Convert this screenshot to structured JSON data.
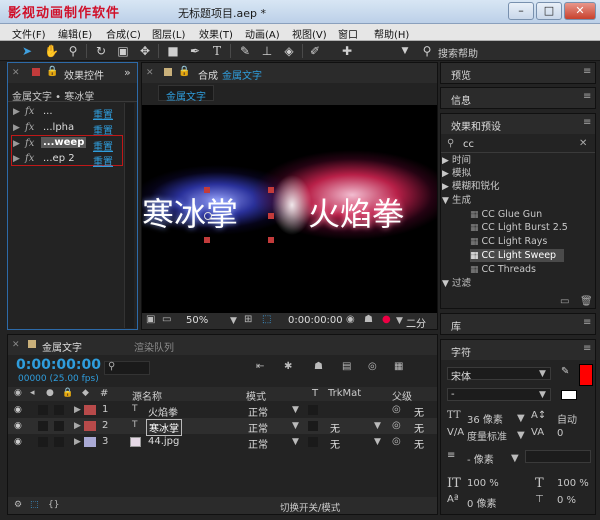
{
  "titlebar": {
    "watermark": "影视动画制作软件",
    "title": "无标题项目.aep *",
    "min": "–",
    "max": "□",
    "close": "✕"
  },
  "menu": [
    "文件(F)",
    "编辑(E)",
    "合成(C)",
    "图层(L)",
    "效果(T)",
    "动画(A)",
    "视图(V)",
    "窗口",
    "帮助(H)"
  ],
  "toolbar": {
    "search_help": "搜索帮助"
  },
  "effect_controls": {
    "tab": "效果控件",
    "breadcrumb": "金属文字 • 寒冰掌",
    "rows": [
      {
        "fx": "fx",
        "name": "...",
        "reset": "重置"
      },
      {
        "fx": "fx",
        "name": "...lpha",
        "reset": "重置"
      },
      {
        "fx": "fx",
        "name": "...weep",
        "reset": "重置"
      },
      {
        "fx": "fx",
        "name": "...ep 2",
        "reset": "重置"
      }
    ]
  },
  "composition": {
    "tab_prefix": "合成",
    "tab_name": "金属文字",
    "subtab": "金属文字",
    "text_left": "寒冰掌",
    "text_right": "火焰拳",
    "zoom": "50%",
    "timecode": "0:00:00:00",
    "resolution": "二分"
  },
  "right_panels": {
    "preview": "预览",
    "info": "信息",
    "effects_presets": "效果和预设",
    "search_value": "cc",
    "categories": [
      {
        "arrow": "▶",
        "label": "时间"
      },
      {
        "arrow": "▶",
        "label": "模拟"
      },
      {
        "arrow": "▶",
        "label": "模糊和锐化"
      },
      {
        "arrow": "▼",
        "label": "生成"
      }
    ],
    "generate_items": [
      "CC Glue Gun",
      "CC Light Burst 2.5",
      "CC Light Rays",
      "CC Light Sweep",
      "CC Threads"
    ],
    "filter_category": "过滤",
    "library": "库",
    "character": "字符"
  },
  "character": {
    "font": "宋体",
    "style": "-",
    "size": "36 像素",
    "leading": "自动",
    "tracking_label": "度量标准",
    "tracking": "0",
    "stroke": "- 像素",
    "vscale": "100 %",
    "hscale": "100 %",
    "baseline": "0 像素",
    "tsume": "0 %"
  },
  "timeline": {
    "tab": "金属文字",
    "render_queue": "渲染队列",
    "timecode": "0:00:00:00",
    "frames": "00000 (25.00 fps)",
    "columns": {
      "num": "#",
      "name": "源名称",
      "mode": "模式",
      "t": "T",
      "trkmat": "TrkMat",
      "parent": "父级"
    },
    "layers": [
      {
        "num": "1",
        "name": "火焰拳",
        "mode": "正常",
        "trkmat": "",
        "parent": "无",
        "color": "#b84a4a"
      },
      {
        "num": "2",
        "name": "寒冰掌",
        "mode": "正常",
        "trkmat": "无",
        "parent": "无",
        "color": "#b84a4a"
      },
      {
        "num": "3",
        "name": "44.jpg",
        "mode": "正常",
        "trkmat": "无",
        "parent": "无",
        "color": "#a9a9d4"
      }
    ],
    "footer": "切换开关/模式"
  }
}
